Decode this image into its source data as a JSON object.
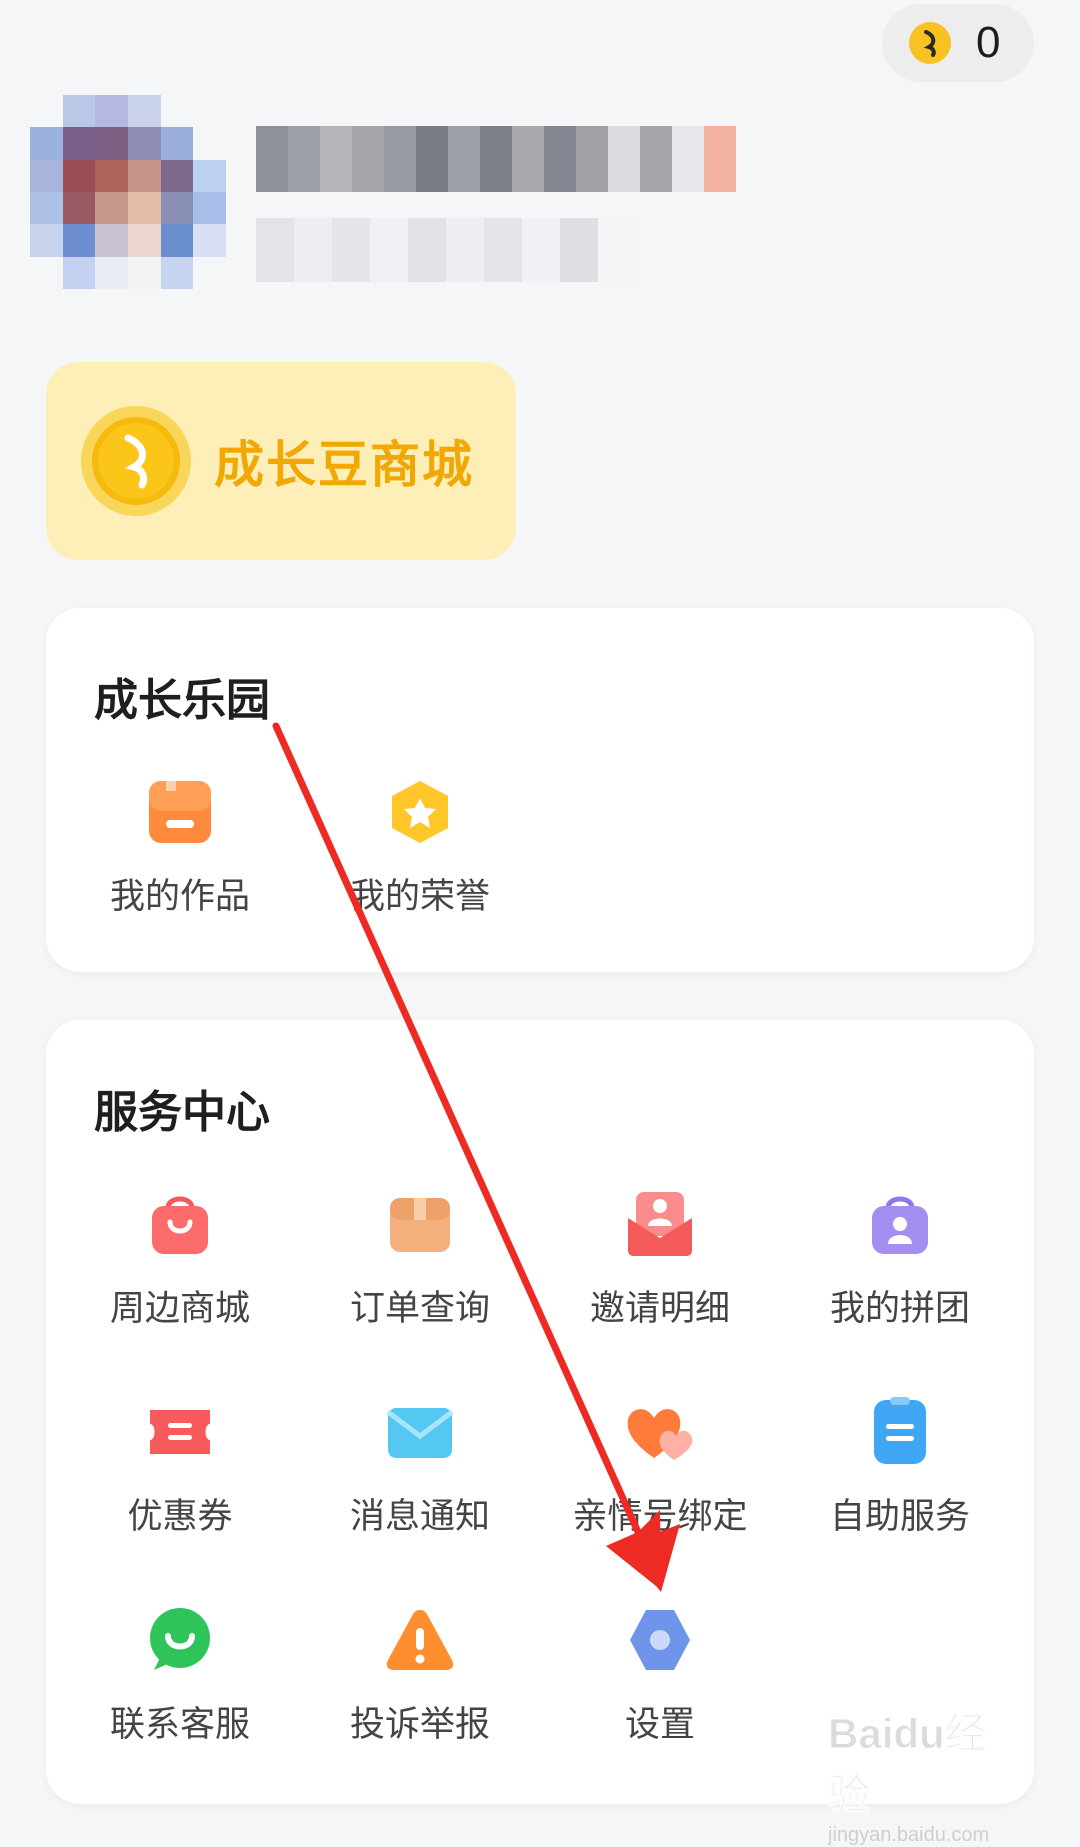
{
  "header": {
    "coin_count": "0"
  },
  "mall_banner": {
    "label": "成长豆商城"
  },
  "growth_section": {
    "title": "成长乐园",
    "items": [
      {
        "label": "我的作品",
        "icon": "works-icon"
      },
      {
        "label": "我的荣誉",
        "icon": "honor-badge-icon"
      }
    ]
  },
  "service_section": {
    "title": "服务中心",
    "items": [
      {
        "label": "周边商城",
        "icon": "shopping-bag-icon"
      },
      {
        "label": "订单查询",
        "icon": "order-box-icon"
      },
      {
        "label": "邀请明细",
        "icon": "invite-envelope-icon"
      },
      {
        "label": "我的拼团",
        "icon": "group-buy-icon"
      },
      {
        "label": "优惠券",
        "icon": "coupon-icon"
      },
      {
        "label": "消息通知",
        "icon": "message-mail-icon"
      },
      {
        "label": "亲情号绑定",
        "icon": "family-heart-icon"
      },
      {
        "label": "自助服务",
        "icon": "self-service-icon"
      },
      {
        "label": "联系客服",
        "icon": "customer-service-chat-icon"
      },
      {
        "label": "投诉举报",
        "icon": "report-warning-icon"
      },
      {
        "label": "设置",
        "icon": "settings-gear-icon"
      }
    ]
  },
  "watermark": {
    "text": "Baidu经验",
    "sub": "jingyan.baidu.com"
  },
  "colors": {
    "coin": "#f8c322",
    "banner_bg": "#fdefb7",
    "banner_text": "#f2a804",
    "annotation_arrow": "#ee2a24"
  }
}
